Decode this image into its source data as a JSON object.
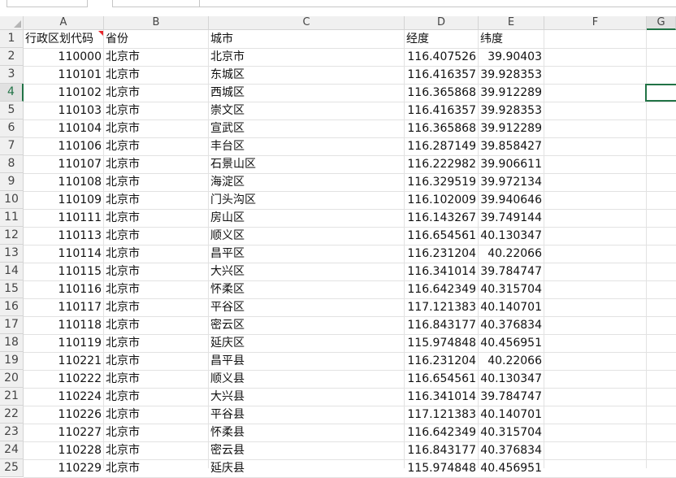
{
  "columns": [
    "A",
    "B",
    "C",
    "D",
    "E",
    "F",
    "G"
  ],
  "selected_column": "G",
  "selected_row": "4",
  "header_row": {
    "row_number": "1",
    "cells": [
      "行政区划代码",
      "省份",
      "城市",
      "经度",
      "纬度"
    ]
  },
  "rows": [
    {
      "row_number": "2",
      "cells": [
        "110000",
        "北京市",
        "北京市",
        "116.407526",
        "39.90403"
      ]
    },
    {
      "row_number": "3",
      "cells": [
        "110101",
        "北京市",
        "东城区",
        "116.416357",
        "39.928353"
      ]
    },
    {
      "row_number": "4",
      "cells": [
        "110102",
        "北京市",
        "西城区",
        "116.365868",
        "39.912289"
      ]
    },
    {
      "row_number": "5",
      "cells": [
        "110103",
        "北京市",
        "崇文区",
        "116.416357",
        "39.928353"
      ]
    },
    {
      "row_number": "6",
      "cells": [
        "110104",
        "北京市",
        "宣武区",
        "116.365868",
        "39.912289"
      ]
    },
    {
      "row_number": "7",
      "cells": [
        "110106",
        "北京市",
        "丰台区",
        "116.287149",
        "39.858427"
      ]
    },
    {
      "row_number": "8",
      "cells": [
        "110107",
        "北京市",
        "石景山区",
        "116.222982",
        "39.906611"
      ]
    },
    {
      "row_number": "9",
      "cells": [
        "110108",
        "北京市",
        "海淀区",
        "116.329519",
        "39.972134"
      ]
    },
    {
      "row_number": "10",
      "cells": [
        "110109",
        "北京市",
        "门头沟区",
        "116.102009",
        "39.940646"
      ]
    },
    {
      "row_number": "11",
      "cells": [
        "110111",
        "北京市",
        "房山区",
        "116.143267",
        "39.749144"
      ]
    },
    {
      "row_number": "12",
      "cells": [
        "110113",
        "北京市",
        "顺义区",
        "116.654561",
        "40.130347"
      ]
    },
    {
      "row_number": "13",
      "cells": [
        "110114",
        "北京市",
        "昌平区",
        "116.231204",
        "40.22066"
      ]
    },
    {
      "row_number": "14",
      "cells": [
        "110115",
        "北京市",
        "大兴区",
        "116.341014",
        "39.784747"
      ]
    },
    {
      "row_number": "15",
      "cells": [
        "110116",
        "北京市",
        "怀柔区",
        "116.642349",
        "40.315704"
      ]
    },
    {
      "row_number": "16",
      "cells": [
        "110117",
        "北京市",
        "平谷区",
        "117.121383",
        "40.140701"
      ]
    },
    {
      "row_number": "17",
      "cells": [
        "110118",
        "北京市",
        "密云区",
        "116.843177",
        "40.376834"
      ]
    },
    {
      "row_number": "18",
      "cells": [
        "110119",
        "北京市",
        "延庆区",
        "115.974848",
        "40.456951"
      ]
    },
    {
      "row_number": "19",
      "cells": [
        "110221",
        "北京市",
        "昌平县",
        "116.231204",
        "40.22066"
      ]
    },
    {
      "row_number": "20",
      "cells": [
        "110222",
        "北京市",
        "顺义县",
        "116.654561",
        "40.130347"
      ]
    },
    {
      "row_number": "21",
      "cells": [
        "110224",
        "北京市",
        "大兴县",
        "116.341014",
        "39.784747"
      ]
    },
    {
      "row_number": "22",
      "cells": [
        "110226",
        "北京市",
        "平谷县",
        "117.121383",
        "40.140701"
      ]
    },
    {
      "row_number": "23",
      "cells": [
        "110227",
        "北京市",
        "怀柔县",
        "116.642349",
        "40.315704"
      ]
    },
    {
      "row_number": "24",
      "cells": [
        "110228",
        "北京市",
        "密云县",
        "116.843177",
        "40.376834"
      ]
    },
    {
      "row_number": "25",
      "cells": [
        "110229",
        "北京市",
        "延庆县",
        "115.974848",
        "40.456951"
      ]
    }
  ]
}
